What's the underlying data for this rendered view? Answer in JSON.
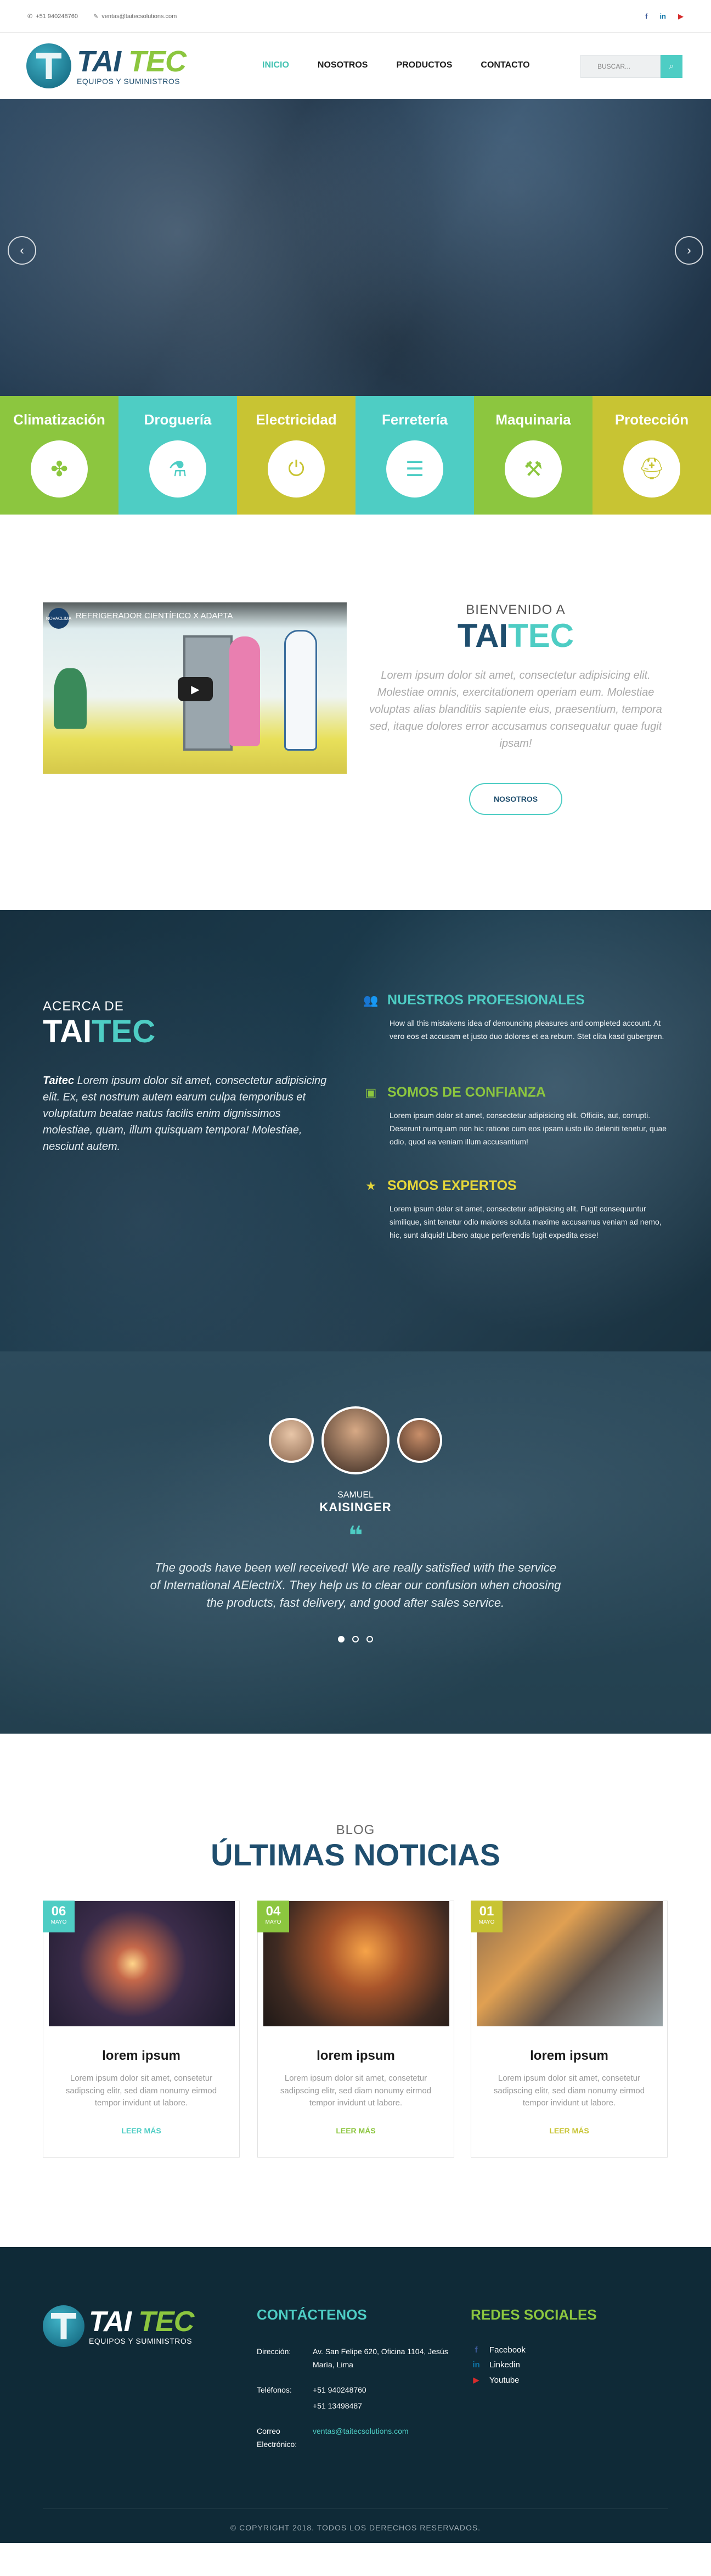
{
  "topbar": {
    "phone": "+51 940248760",
    "email": "ventas@taitecsolutions.com",
    "social": [
      {
        "icon": "facebook-icon",
        "glyph": "f",
        "color": "#3b5998"
      },
      {
        "icon": "linkedin-icon",
        "glyph": "in",
        "color": "#0e76a8"
      },
      {
        "icon": "youtube-icon",
        "glyph": "▶",
        "color": "#d62c2c"
      }
    ]
  },
  "header": {
    "logo_a": "TAI",
    "logo_b": "TEC",
    "logo_sub": "EQUIPOS Y SUMINISTROS",
    "nav": [
      "INICIO",
      "NOSOTROS",
      "PRODUCTOS",
      "CONTACTO"
    ],
    "search_placeholder": "BUSCAR..."
  },
  "hero": {
    "prev": "‹",
    "next": "›"
  },
  "categories": [
    {
      "label": "Climatización",
      "bg": "#8cc63f",
      "color": "#8cc63f",
      "icon": "fan-icon",
      "glyph": "✤"
    },
    {
      "label": "Droguería",
      "bg": "#4ecdc4",
      "color": "#4ecdc4",
      "icon": "spray-bottle-icon",
      "glyph": "⚗"
    },
    {
      "label": "Electricidad",
      "bg": "#c8c433",
      "color": "#c8c433",
      "icon": "plug-icon",
      "glyph": "⏻"
    },
    {
      "label": "Ferretería",
      "bg": "#4ecdc4",
      "color": "#4ecdc4",
      "icon": "tools-icon",
      "glyph": "☰"
    },
    {
      "label": "Maquinaria",
      "bg": "#8cc63f",
      "color": "#8cc63f",
      "icon": "drill-icon",
      "glyph": "⚒"
    },
    {
      "label": "Protección",
      "bg": "#c8c433",
      "color": "#c8c433",
      "icon": "helmet-icon",
      "glyph": "⛑"
    }
  ],
  "welcome": {
    "video_title": "REFRIGERADOR CIENTÍFICO X ADAPTA",
    "video_channel": "NOVACLIMA",
    "small": "BIENVENIDO A",
    "big_a": "TAI",
    "big_b": "TEC",
    "text": "Lorem ipsum dolor sit amet, consectetur adipisicing elit. Molestiae omnis, exercitationem operiam eum. Molestiae voluptas alias blanditiis sapiente eius, praesentium, tempora sed, itaque dolores error accusamus consequatur quae fugit ipsam!",
    "button": "NOSOTROS"
  },
  "about": {
    "small": "ACERCA DE",
    "big_a": "TAI",
    "big_b": "TEC",
    "brand": "Taitec",
    "text": " Lorem ipsum dolor sit amet, consectetur adipisicing elit. Ex, est nostrum autem earum culpa temporibus et voluptatum beatae natus facilis enim dignissimos molestiae, quam, illum quisquam tempora! Molestiae, nesciunt autem.",
    "features": [
      {
        "title": "NUESTROS PROFESIONALES",
        "icon": "users-icon",
        "glyph": "👥",
        "text": "How all this mistakens idea of denouncing pleasures and completed account. At vero eos et accusam et justo duo dolores et ea rebum. Stet clita kasd gubergren."
      },
      {
        "title": "SOMOS DE CONFIANZA",
        "icon": "briefcase-icon",
        "glyph": "▣",
        "text": "Lorem ipsum dolor sit amet, consectetur adipisicing elit. Officiis, aut, corrupti. Deserunt numquam non hic ratione cum eos ipsam iusto illo deleniti tenetur, quae odio, quod ea veniam illum accusantium!"
      },
      {
        "title": "SOMOS EXPERTOS",
        "icon": "star-icon",
        "glyph": "★",
        "text": "Lorem ipsum dolor sit amet, consectetur adipisicing elit. Fugit consequuntur similique, sint tenetur odio maiores soluta maxime accusamus veniam ad nemo, hic, sunt aliquid! Libero atque perferendis fugit expedita esse!"
      }
    ]
  },
  "testimonial": {
    "first": "SAMUEL",
    "last": "KAISINGER",
    "quote_mark": "❝",
    "text": "The goods have been well received! We are really satisfied with the service of International AElectriX. They help us to clear our confusion when choosing the products, fast delivery, and good after sales service."
  },
  "blog": {
    "small": "BLOG",
    "big": "ÚLTIMAS NOTICIAS",
    "posts": [
      {
        "day": "06",
        "month": "MAYO",
        "title": "lorem ipsum",
        "text": "Lorem ipsum dolor sit amet, consetetur sadipscing elitr, sed diam nonumy eirmod tempor invidunt ut labore.",
        "more": "LEER MÁS",
        "color": "#4ecdc4"
      },
      {
        "day": "04",
        "month": "MAYO",
        "title": "lorem ipsum",
        "text": "Lorem ipsum dolor sit amet, consetetur sadipscing elitr, sed diam nonumy eirmod tempor invidunt ut labore.",
        "more": "LEER MÁS",
        "color": "#8cc63f"
      },
      {
        "day": "01",
        "month": "MAYO",
        "title": "lorem ipsum",
        "text": "Lorem ipsum dolor sit amet, consetetur sadipscing elitr, sed diam nonumy eirmod tempor invidunt ut labore.",
        "more": "LEER MÁS",
        "color": "#c8c433"
      }
    ]
  },
  "footer": {
    "logo_a": "TAI",
    "logo_b": "TEC",
    "logo_sub": "EQUIPOS Y SUMINISTROS",
    "contact_title": "CONTÁCTENOS",
    "address_label": "Dirección:",
    "address": "Av. San Felipe 620, Oficina 1104, Jesús María, Lima",
    "phones_label": "Teléfonos:",
    "phone1": "+51 940248760",
    "phone2": "+51 13498487",
    "email_label": "Correo Electrónico:",
    "email": "ventas@taitecsolutions.com",
    "social_title": "REDES SOCIALES",
    "social": [
      {
        "label": "Facebook",
        "icon": "facebook-icon",
        "glyph": "f",
        "color": "#3b5998"
      },
      {
        "label": "Linkedin",
        "icon": "linkedin-icon",
        "glyph": "in",
        "color": "#0e76a8"
      },
      {
        "label": "Youtube",
        "icon": "youtube-icon",
        "glyph": "▶",
        "color": "#d62c2c"
      }
    ],
    "copyright": "© COPYRIGHT 2018. TODOS LOS DERECHOS RESERVADOS."
  }
}
